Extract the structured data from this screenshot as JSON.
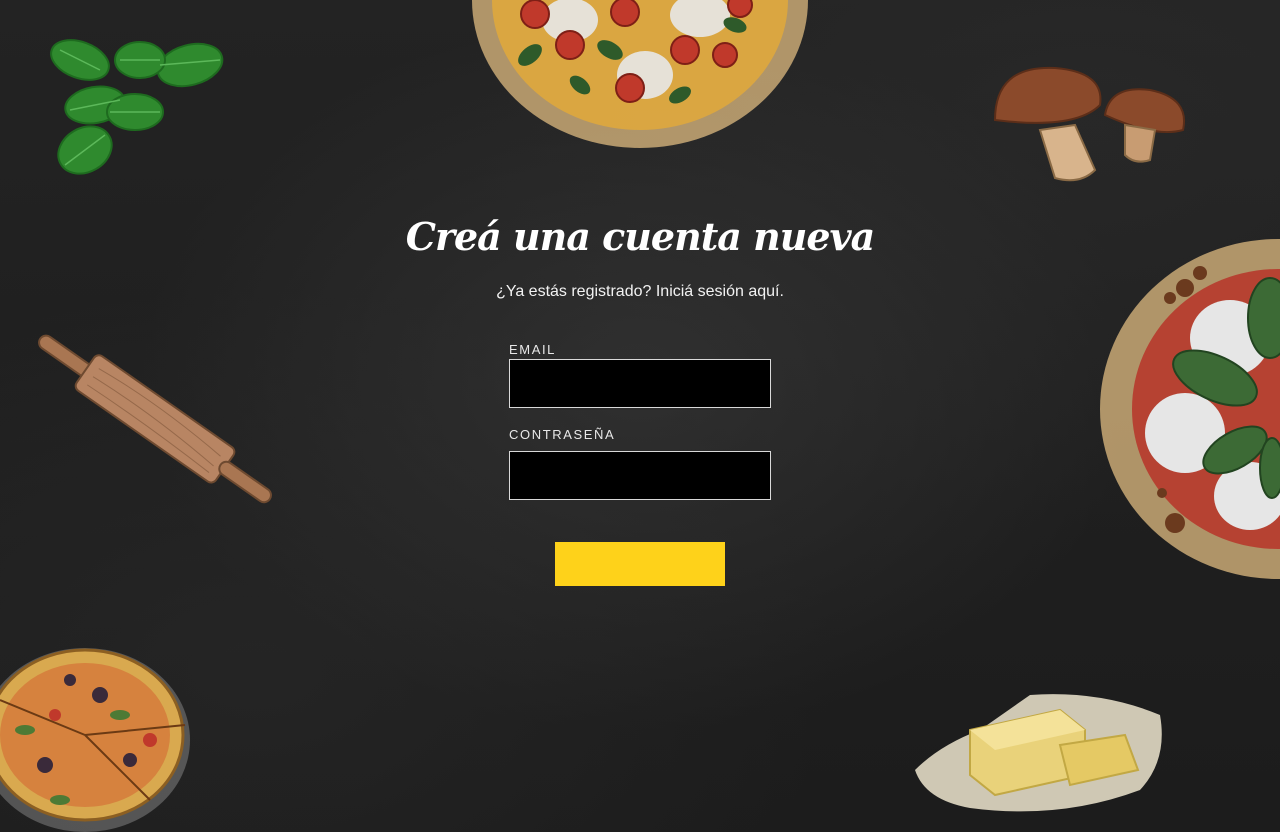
{
  "page": {
    "title": "Creá una cuenta nueva",
    "login_prompt": "¿Ya estás registrado? Iniciá sesión aquí."
  },
  "form": {
    "email_label": "EMAIL",
    "email_value": "",
    "password_label": "CONTRASEÑA",
    "password_value": "",
    "submit_label": ""
  },
  "colors": {
    "background": "#1f1f1f",
    "accent": "#fed21a",
    "input_background": "#000000",
    "input_border": "#d9d9d9"
  },
  "decorations": [
    "basil-leaves-illustration",
    "pizza-top-illustration",
    "mushrooms-illustration",
    "rolling-pin-illustration",
    "pizza-right-illustration",
    "pizza-slices-illustration",
    "butter-illustration"
  ]
}
